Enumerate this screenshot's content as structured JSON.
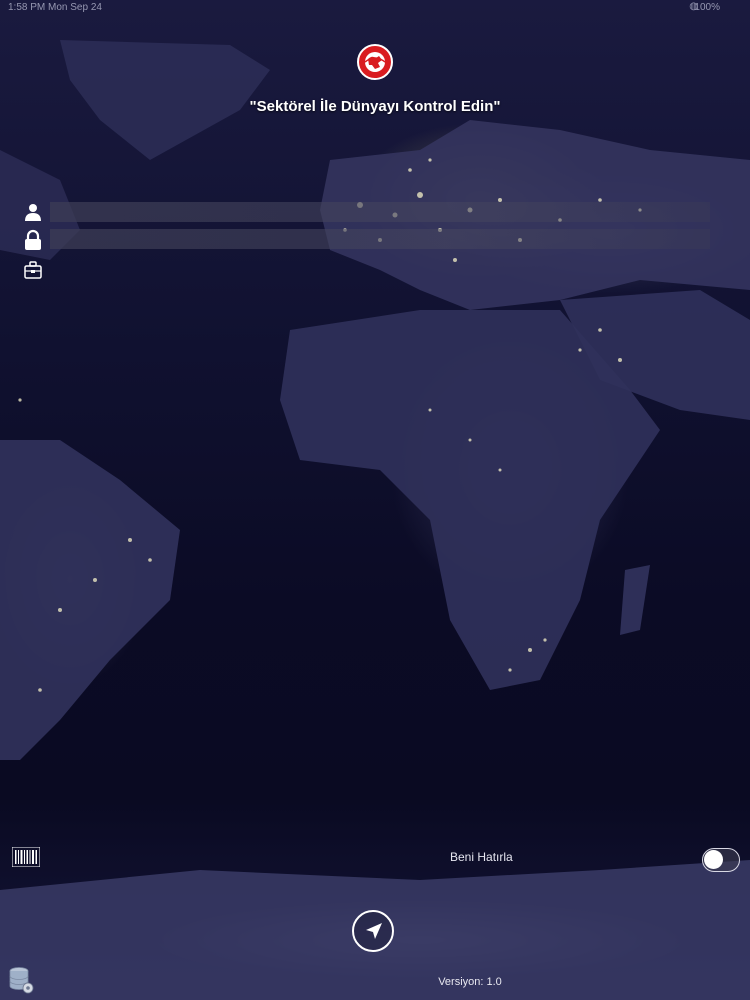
{
  "status_bar": {
    "time": "1:58 PM  Mon Sep 24",
    "battery": "100%"
  },
  "header": {
    "tagline": "\"Sektörel İle Dünyayı Kontrol Edin\""
  },
  "login": {
    "username_placeholder": "",
    "password_placeholder": ""
  },
  "footer": {
    "remember_label": "Beni Hatırla",
    "remember_on": false,
    "version_label": "Versiyon: 1.0"
  },
  "icons": {
    "logo": "globe-logo-icon",
    "user": "user-icon",
    "lock": "lock-icon",
    "company": "briefcase-icon",
    "barcode": "barcode-icon",
    "navigate": "location-arrow-icon",
    "database": "database-icon"
  },
  "colors": {
    "background": "#0c0d26",
    "logo_red": "#d91c20",
    "text": "#ffffff"
  }
}
